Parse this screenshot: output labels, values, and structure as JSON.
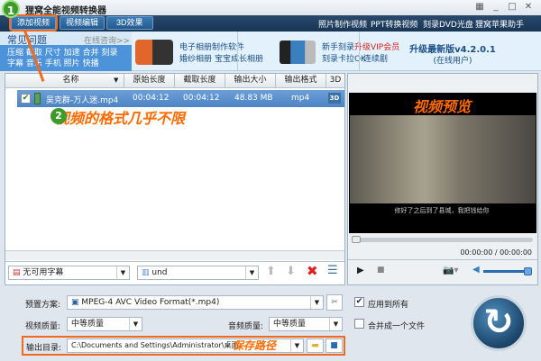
{
  "window": {
    "title": "狸窝全能视频转换器"
  },
  "toolbar": {
    "add_video": "添加视频",
    "video_edit": "视频编辑",
    "effect_3d": "3D效果",
    "links": [
      "照片制作视频",
      "PPT转换视频",
      "刻录DVD光盘",
      "狸窝苹果助手"
    ]
  },
  "faq": {
    "title": "常见问题",
    "online": "在线咨询>>",
    "links": [
      "压缩",
      "截取",
      "尺寸",
      "加速",
      "合并",
      "刻录",
      "字幕",
      "音乐",
      "手机",
      "照片",
      "快播"
    ]
  },
  "promo1": {
    "line1": "电子相册制作软件",
    "line2a": "婚纱相册",
    "line2b": "宝宝成长相册"
  },
  "promo2": {
    "line1a": "新手刻录",
    "line1b": "升级VIP会员",
    "line2a": "刻录卡拉OK",
    "line2b": "连续剧"
  },
  "upgrade": {
    "title": "升级最新版v4.2.0.1",
    "subtitle": "(在线用户)"
  },
  "table": {
    "headers": [
      "名称",
      "原始长度",
      "截取长度",
      "输出大小",
      "输出格式",
      "3D"
    ],
    "rows": [
      {
        "name": "吴克群-万人迷.mp4",
        "orig": "00:04:12",
        "clip": "00:04:12",
        "size": "48.83 MB",
        "format": "mp4",
        "checked": true
      }
    ]
  },
  "annotations": {
    "step1": "1",
    "step2": "2",
    "formats": "视频的格式几乎不限",
    "preview": "视频预览",
    "save_path": "保存路径"
  },
  "preview": {
    "subtitle": "修好了之后到了县城，我把钱给你",
    "time": "00:00:00 / 00:00:00"
  },
  "subtitle_select": "无可用字幕",
  "audio_select": "und",
  "settings": {
    "preset_label": "预置方案:",
    "preset_value": "MPEG-4 AVC Video Format(*.mp4)",
    "apply_all": "应用到所有",
    "video_quality_label": "视频质量:",
    "video_quality": "中等质量",
    "audio_quality_label": "音频质量:",
    "audio_quality": "中等质量",
    "merge": "合并成一个文件",
    "output_label": "输出目录:",
    "output_path": "C:\\Documents and Settings\\Administrator\\桌面"
  }
}
